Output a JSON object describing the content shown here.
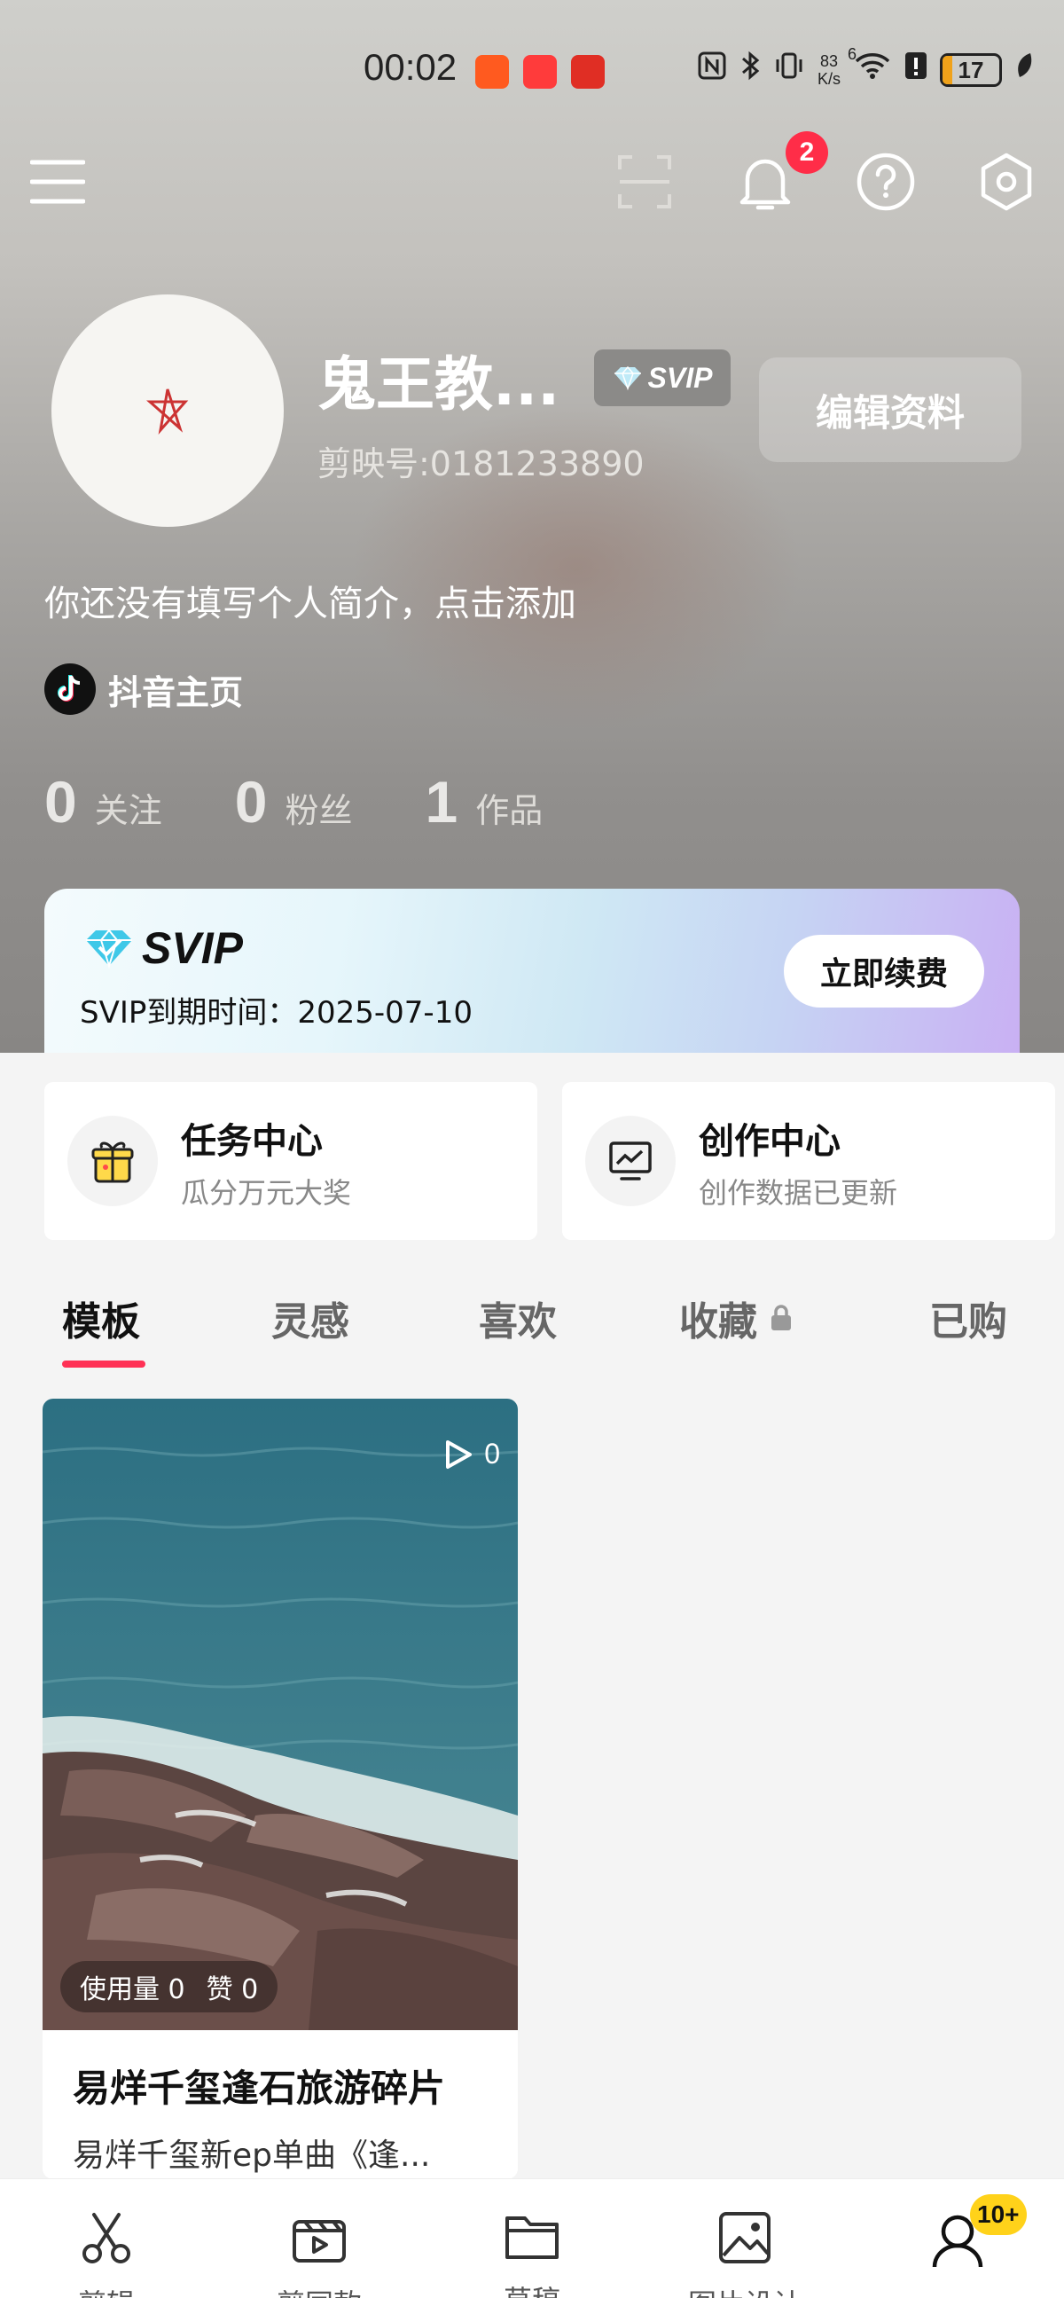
{
  "status_bar": {
    "time": "00:02",
    "net_speed_value": "83",
    "net_speed_unit": "K/s",
    "signal_label": "6",
    "battery": "17",
    "battery_level": 0.17
  },
  "top_bar": {
    "notification_count": "2"
  },
  "profile": {
    "name": "鬼王教...",
    "badge": "SVIP",
    "id_text": "剪映号:0181233890",
    "edit_button": "编辑资料",
    "bio": "你还没有填写个人简介，点击添加",
    "douyin_link": "抖音主页"
  },
  "stats": [
    {
      "num": "0",
      "label": "关注"
    },
    {
      "num": "0",
      "label": "粉丝"
    },
    {
      "num": "1",
      "label": "作品"
    }
  ],
  "svip_banner": {
    "title": "SVIP",
    "expire_text": "SVIP到期时间：2025-07-10",
    "renew_button": "立即续费"
  },
  "cards": [
    {
      "title": "任务中心",
      "subtitle": "瓜分万元大奖",
      "icon": "gift-icon"
    },
    {
      "title": "创作中心",
      "subtitle": "创作数据已更新",
      "icon": "monitor-chart-icon"
    }
  ],
  "tabs": [
    {
      "label": "模板",
      "active": true
    },
    {
      "label": "灵感"
    },
    {
      "label": "喜欢"
    },
    {
      "label": "收藏",
      "locked": true
    },
    {
      "label": "已购"
    }
  ],
  "template": {
    "plays": "0",
    "usage_label": "使用量 0",
    "likes_label": "赞 0",
    "title": "易烊千玺逢石旅游碎片",
    "desc": "易烊千玺新ep单曲《逢..."
  },
  "bottom_nav": [
    {
      "label": "剪辑",
      "icon": "scissors-icon"
    },
    {
      "label": "剪同款",
      "icon": "clapper-icon"
    },
    {
      "label": "草稿",
      "icon": "folder-icon"
    },
    {
      "label": "图片设计",
      "icon": "image-icon"
    },
    {
      "label": "",
      "icon": "user-icon",
      "badge": "10+"
    }
  ]
}
